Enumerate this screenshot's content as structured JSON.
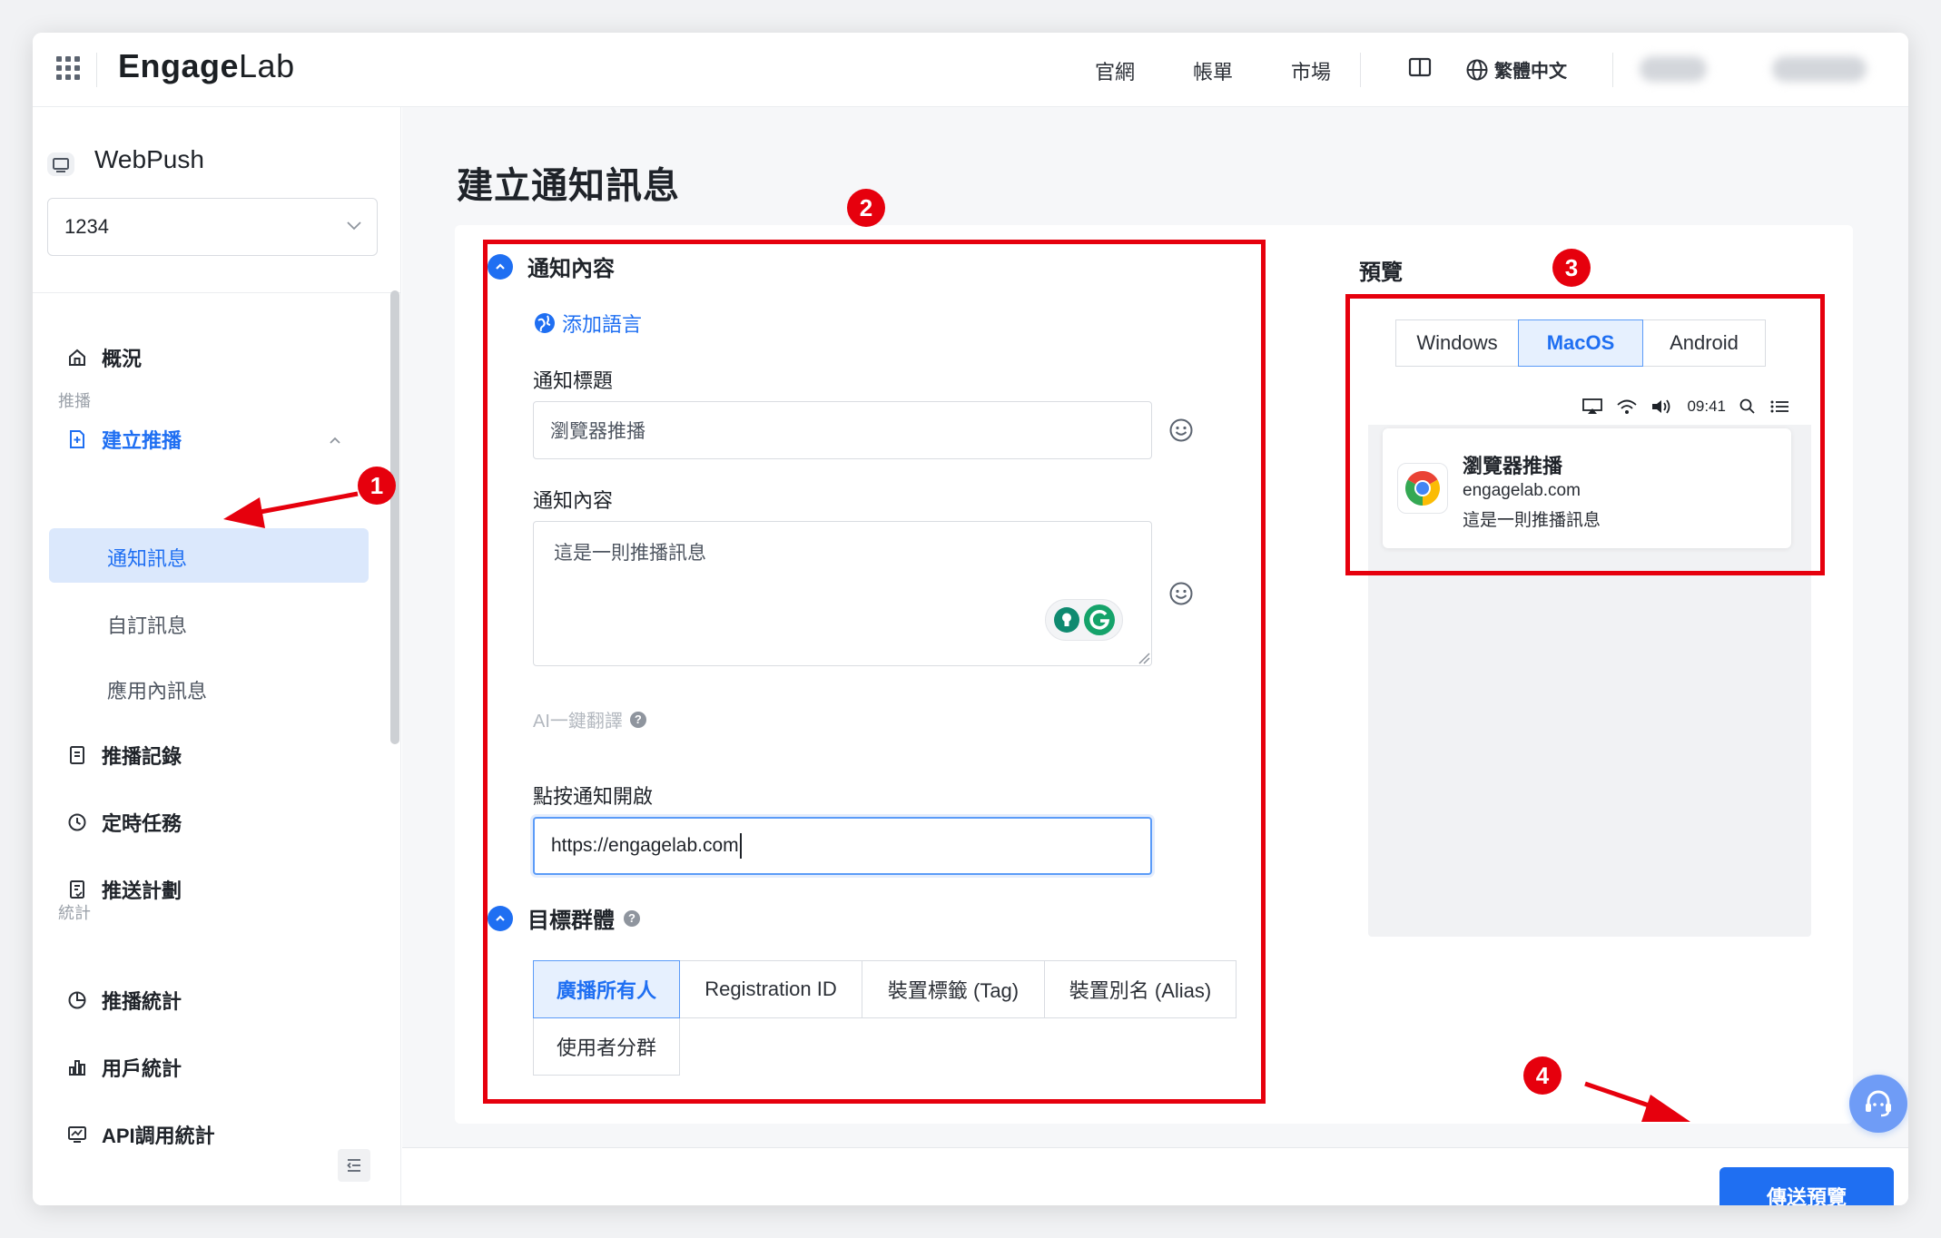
{
  "topbar": {
    "brand": "Engage",
    "brand_suffix": "Lab",
    "nav": [
      "官網",
      "帳單",
      "市場"
    ],
    "language": "繁體中文",
    "icons": [
      "apps-grid-icon",
      "book-icon",
      "globe-icon"
    ]
  },
  "sidebar": {
    "product": "WebPush",
    "app_select": "1234",
    "overview": "概況",
    "group_push": "推播",
    "create_push": "建立推播",
    "sub_notification": "通知訊息",
    "sub_custom": "自訂訊息",
    "sub_inapp": "應用內訊息",
    "push_records": "推播記錄",
    "scheduled_tasks": "定時任務",
    "push_plans": "推送計劃",
    "group_stats": "統計",
    "push_stats": "推播統計",
    "user_stats": "用戶統計",
    "api_stats": "API調用統計"
  },
  "main": {
    "page_title": "建立通知訊息",
    "content_section": "通知內容",
    "add_language": "添加語言",
    "title_label": "通知標題",
    "title_value": "瀏覽器推播",
    "content_label": "通知內容",
    "content_value": "這是一則推播訊息",
    "ai_translate": "AI一鍵翻譯",
    "click_open_label": "點按通知開啟",
    "click_open_value": "https://engagelab.com",
    "target_section": "目標群體",
    "target_tabs": [
      "廣播所有人",
      "Registration ID",
      "裝置標籤 (Tag)",
      "裝置別名 (Alias)",
      "使用者分群"
    ],
    "target_active": "廣播所有人"
  },
  "preview": {
    "title": "預覽",
    "os_tabs": [
      "Windows",
      "MacOS",
      "Android"
    ],
    "os_active": "MacOS",
    "menubar_time": "09:41",
    "notif_title": "瀏覽器推播",
    "notif_domain": "engagelab.com",
    "notif_body": "這是一則推播訊息"
  },
  "footer": {
    "send_preview": "傳送預覽"
  },
  "annotations": [
    "1",
    "2",
    "3",
    "4"
  ],
  "colors": {
    "accent": "#1f6ff2",
    "annotation": "#e6000d",
    "active_bg": "#e6f0fe"
  }
}
